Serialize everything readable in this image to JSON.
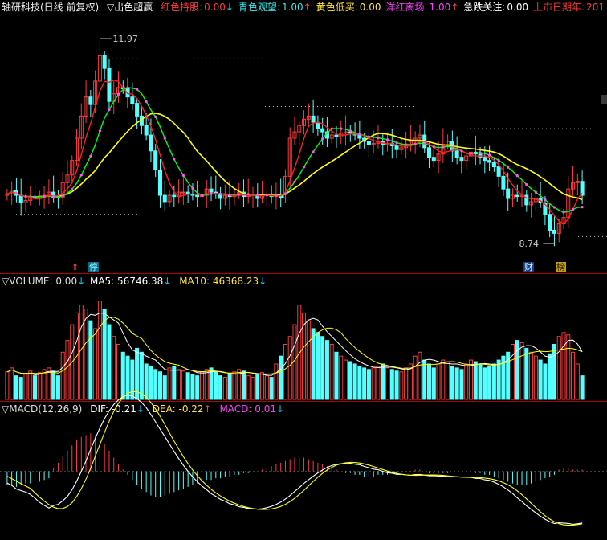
{
  "main": {
    "title": "轴研科技(日线 前复权)",
    "indicator": "▽出色超赢",
    "items": [
      {
        "label": "红色持股:",
        "value": "0.00",
        "arrow": "↓",
        "color": "#ff3b3b",
        "arrow_color": "#00d2ff"
      },
      {
        "label": "青色观望:",
        "value": "1.00",
        "arrow": "↑",
        "color": "#39e6ea",
        "arrow_color": "#ff3b3b"
      },
      {
        "label": "黄色低买:",
        "value": "0.00",
        "arrow": "",
        "color": "#ffe23a",
        "arrow_color": "#ffe23a"
      },
      {
        "label": "洋红离场:",
        "value": "1.00",
        "arrow": "↑",
        "color": "#ff3cff",
        "arrow_color": "#ff3b3b"
      },
      {
        "label": "急跌关注:",
        "value": "0.00",
        "arrow": "",
        "color": "#ffffff",
        "arrow_color": "#ffffff"
      },
      {
        "label": "上市日期年:",
        "value": "201",
        "arrow": "",
        "color": "#ff3b3b",
        "arrow_color": "#ff3b3b"
      }
    ],
    "high_label": "11.97",
    "low_label": "8.74",
    "markers": {
      "ting": "停",
      "cai": "财",
      "bang": "榜"
    }
  },
  "volume": {
    "title": "▽VOLUME:",
    "value": "0.00",
    "arrow": "↓",
    "ma5_label": "MA5:",
    "ma5_value": "56746.38",
    "ma5_arrow": "↓",
    "ma10_label": "MA10:",
    "ma10_value": "46368.23",
    "ma10_arrow": "↓"
  },
  "macd": {
    "title": "▽MACD(12,26,9)",
    "dif_label": "DIF:",
    "dif_value": "-0.21",
    "dif_arrow": "↓",
    "dea_label": "DEA:",
    "dea_value": "-0.22",
    "dea_arrow": "↑",
    "macd_label": "MACD:",
    "macd_value": "0.01",
    "macd_arrow": "↓"
  },
  "colors": {
    "up": "#ff3b3b",
    "down": "#54ffff",
    "ma_short": "#ffffff",
    "ma_yellow": "#ffff00",
    "ma_green": "#00ff00",
    "ma_red": "#ff2020",
    "dots": "#ff55ff"
  },
  "chart_data": {
    "type": "candlestick",
    "dates": [],
    "price": {
      "close": [
        9.52,
        9.58,
        9.5,
        9.38,
        9.42,
        9.48,
        9.45,
        9.49,
        9.5,
        9.55,
        9.47,
        9.46,
        9.7,
        9.82,
        10.05,
        10.4,
        10.75,
        11.05,
        10.93,
        11.3,
        11.7,
        11.5,
        10.98,
        11.1,
        11.2,
        11.18,
        11.05,
        10.95,
        10.75,
        10.6,
        10.45,
        10.2,
        9.9,
        9.5,
        9.4,
        9.5,
        9.48,
        9.55,
        9.55,
        9.52,
        9.5,
        9.48,
        9.5,
        9.6,
        9.55,
        9.52,
        9.45,
        9.5,
        9.48,
        9.52,
        9.55,
        9.48,
        9.5,
        9.52,
        9.45,
        9.5,
        9.52,
        9.48,
        9.5,
        9.46,
        9.8,
        10.4,
        10.5,
        10.6,
        10.7,
        10.75,
        10.65,
        10.55,
        10.5,
        10.4,
        10.45,
        10.42,
        10.48,
        10.5,
        10.48,
        10.45,
        10.4,
        10.35,
        10.3,
        10.32,
        10.35,
        10.3,
        10.32,
        10.28,
        10.22,
        10.25,
        10.3,
        10.35,
        10.4,
        10.45,
        10.25,
        10.1,
        10.05,
        10.15,
        10.3,
        10.35,
        10.2,
        10.1,
        10.05,
        10.12,
        10.18,
        10.15,
        10.1,
        10.05,
        10.02,
        9.95,
        9.8,
        9.6,
        9.45,
        9.5,
        9.48,
        9.5,
        9.35,
        9.4,
        9.45,
        9.38,
        9.2,
        8.95,
        8.9,
        9.05,
        9.15,
        9.6,
        9.7,
        9.72,
        9.5
      ],
      "open": [
        9.5,
        9.52,
        9.58,
        9.5,
        9.38,
        9.42,
        9.48,
        9.45,
        9.49,
        9.5,
        9.55,
        9.47,
        9.46,
        9.7,
        9.82,
        10.05,
        10.4,
        10.75,
        11.05,
        10.93,
        11.3,
        11.7,
        11.5,
        10.98,
        11.1,
        11.2,
        11.18,
        11.05,
        10.95,
        10.75,
        10.6,
        10.45,
        10.2,
        9.9,
        9.5,
        9.4,
        9.5,
        9.48,
        9.55,
        9.55,
        9.52,
        9.5,
        9.48,
        9.5,
        9.6,
        9.55,
        9.52,
        9.45,
        9.5,
        9.48,
        9.52,
        9.55,
        9.48,
        9.5,
        9.52,
        9.45,
        9.5,
        9.52,
        9.48,
        9.5,
        9.46,
        9.8,
        10.4,
        10.5,
        10.6,
        10.7,
        10.75,
        10.65,
        10.55,
        10.5,
        10.4,
        10.45,
        10.42,
        10.48,
        10.5,
        10.48,
        10.45,
        10.4,
        10.35,
        10.3,
        10.32,
        10.35,
        10.3,
        10.32,
        10.28,
        10.22,
        10.25,
        10.3,
        10.35,
        10.4,
        10.45,
        10.25,
        10.1,
        10.05,
        10.15,
        10.3,
        10.35,
        10.2,
        10.1,
        10.05,
        10.12,
        10.18,
        10.15,
        10.1,
        10.05,
        10.02,
        9.95,
        9.8,
        9.6,
        9.45,
        9.5,
        9.48,
        9.5,
        9.35,
        9.4,
        9.45,
        9.38,
        9.2,
        8.95,
        8.9,
        9.05,
        9.15,
        9.6,
        9.7,
        9.72
      ],
      "high_value": 11.97,
      "low_value": 8.74,
      "ylim": [
        8.5,
        12.3
      ]
    },
    "volume": [
      35,
      40,
      30,
      28,
      32,
      36,
      30,
      34,
      38,
      40,
      36,
      30,
      60,
      75,
      95,
      110,
      120,
      115,
      100,
      90,
      125,
      115,
      95,
      80,
      70,
      60,
      55,
      50,
      65,
      60,
      45,
      42,
      38,
      35,
      30,
      40,
      42,
      38,
      36,
      34,
      32,
      30,
      35,
      38,
      40,
      35,
      30,
      28,
      32,
      35,
      38,
      36,
      30,
      28,
      32,
      34,
      30,
      28,
      45,
      55,
      70,
      80,
      95,
      120,
      110,
      100,
      90,
      85,
      80,
      75,
      70,
      60,
      55,
      50,
      48,
      45,
      42,
      40,
      38,
      40,
      42,
      45,
      40,
      38,
      36,
      35,
      40,
      45,
      55,
      60,
      50,
      45,
      40,
      45,
      50,
      48,
      42,
      40,
      38,
      45,
      50,
      48,
      45,
      40,
      42,
      45,
      50,
      55,
      60,
      70,
      75,
      72,
      65,
      60,
      55,
      50,
      45,
      58,
      70,
      80,
      85,
      82,
      60,
      45,
      30
    ],
    "volume_ylim": [
      0,
      140
    ],
    "macd_hist": [
      -0.08,
      -0.08,
      -0.09,
      -0.08,
      -0.07,
      -0.07,
      -0.06,
      -0.06,
      -0.05,
      -0.04,
      0.02,
      0.05,
      0.09,
      0.12,
      0.15,
      0.18,
      0.2,
      0.21,
      0.22,
      0.21,
      0.19,
      0.16,
      0.12,
      0.08,
      0.04,
      0.01,
      -0.02,
      -0.05,
      -0.08,
      -0.1,
      -0.12,
      -0.14,
      -0.15,
      -0.15,
      -0.14,
      -0.13,
      -0.12,
      -0.11,
      -0.1,
      -0.09,
      -0.08,
      -0.07,
      -0.06,
      -0.05,
      -0.05,
      -0.04,
      -0.04,
      -0.03,
      -0.03,
      -0.02,
      -0.02,
      -0.01,
      -0.01,
      0.0,
      0.0,
      0.01,
      0.02,
      0.03,
      0.04,
      0.05,
      0.06,
      0.07,
      0.08,
      0.08,
      0.08,
      0.07,
      0.06,
      0.05,
      0.04,
      0.03,
      0.02,
      0.01,
      0.0,
      -0.01,
      -0.01,
      -0.02,
      -0.02,
      -0.03,
      -0.03,
      -0.03,
      -0.02,
      -0.02,
      -0.02,
      -0.01,
      -0.01,
      0.0,
      0.0,
      0.0,
      0.01,
      0.01,
      0.0,
      -0.01,
      -0.01,
      -0.01,
      -0.01,
      -0.01,
      0.0,
      0.0,
      0.0,
      0.0,
      0.0,
      -0.01,
      -0.01,
      -0.02,
      -0.02,
      -0.03,
      -0.04,
      -0.05,
      -0.06,
      -0.07,
      -0.08,
      -0.08,
      -0.08,
      -0.07,
      -0.06,
      -0.05,
      -0.04,
      -0.03,
      -0.02,
      0.01,
      0.02,
      0.02,
      0.01,
      0.01,
      0.01
    ],
    "macd_ylim": [
      -0.38,
      0.32
    ]
  }
}
